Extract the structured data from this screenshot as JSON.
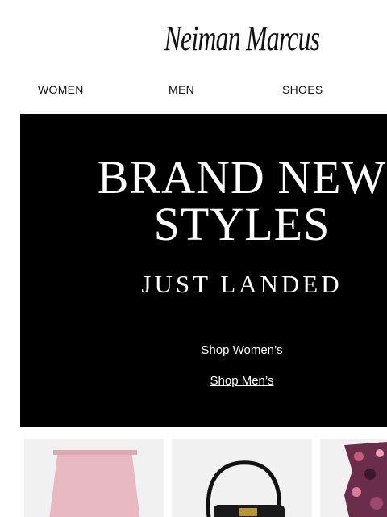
{
  "brand": {
    "name": "Neiman Marcus"
  },
  "nav": {
    "items": [
      "WOMEN",
      "MEN",
      "SHOES"
    ]
  },
  "hero": {
    "title_line1": "BRAND NEW",
    "title_line2": "STYLES",
    "subtitle": "JUST LANDED",
    "link_women": "Shop Women’s",
    "link_men": "Shop Men’s"
  },
  "products": [
    {
      "image": "pink-skirt"
    },
    {
      "image": "black-shoulder-bag"
    },
    {
      "image": "printed-top"
    }
  ],
  "colors": {
    "hero_bg": "#000000",
    "skirt": "#e8b9c2"
  }
}
